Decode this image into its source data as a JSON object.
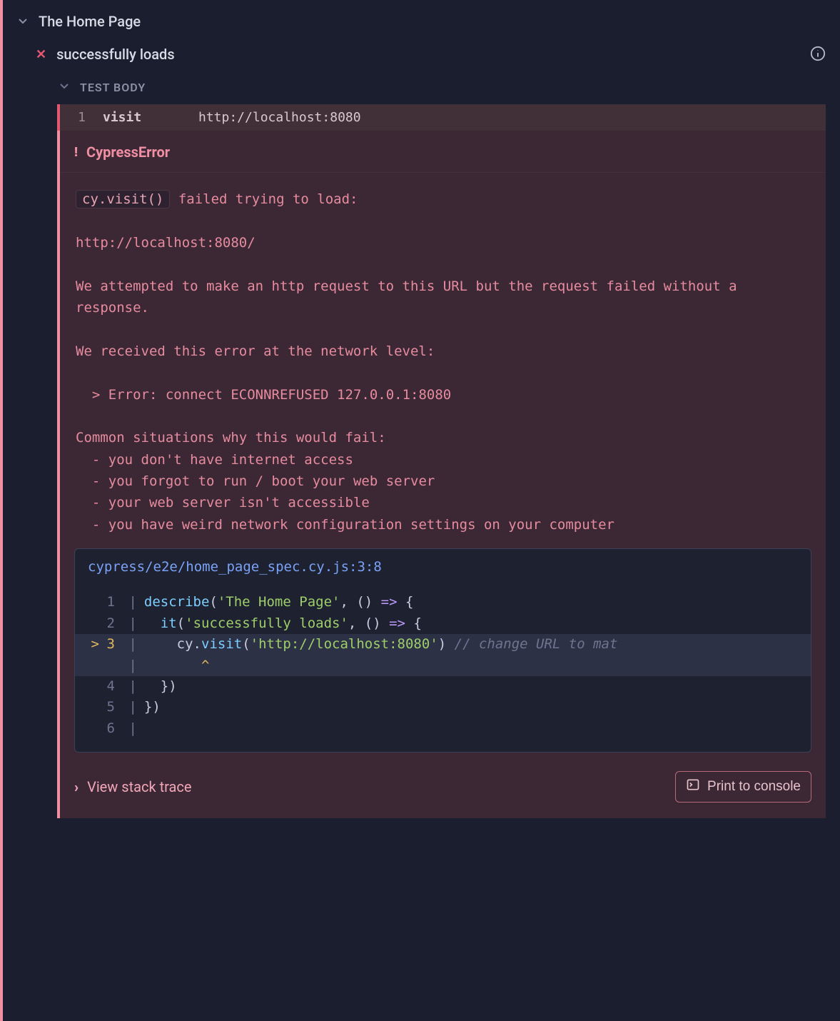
{
  "suite": {
    "title": "The Home Page"
  },
  "test": {
    "title": "successfully loads",
    "status": "failed"
  },
  "section": {
    "label": "TEST BODY"
  },
  "command": {
    "index": "1",
    "name": "visit",
    "arg": "http://localhost:8080"
  },
  "error": {
    "title": "CypressError",
    "code_chip": "cy.visit()",
    "msg_after_chip": " failed trying to load:",
    "url": "http://localhost:8080/",
    "para1": "We attempted to make an http request to this URL but the request failed without a response.",
    "para2": "We received this error at the network level:",
    "net_error": "  > Error: connect ECONNREFUSED 127.0.0.1:8080",
    "common_header": "Common situations why this would fail:",
    "bullets": [
      "  - you don't have internet access",
      "  - you forgot to run / boot your web server",
      "  - your web server isn't accessible",
      "  - you have weird network configuration settings on your computer"
    ]
  },
  "code": {
    "path": "cypress/e2e/home_page_spec.cy.js:3:8",
    "caret": "       ^",
    "lines": [
      {
        "n": "1",
        "hl": false,
        "tokens": [
          [
            "fn",
            "describe"
          ],
          [
            "punc",
            "("
          ],
          [
            "str",
            "'The Home Page'"
          ],
          [
            "punc",
            ", () "
          ],
          [
            "kw",
            "=>"
          ],
          [
            "punc",
            " {"
          ]
        ]
      },
      {
        "n": "2",
        "hl": false,
        "tokens": [
          [
            "punc",
            "  "
          ],
          [
            "fn",
            "it"
          ],
          [
            "punc",
            "("
          ],
          [
            "str",
            "'successfully loads'"
          ],
          [
            "punc",
            ", () "
          ],
          [
            "kw",
            "=>"
          ],
          [
            "punc",
            " {"
          ]
        ]
      },
      {
        "n": "3",
        "hl": true,
        "tokens": [
          [
            "punc",
            "    "
          ],
          [
            "id",
            "cy"
          ],
          [
            "punc",
            "."
          ],
          [
            "fn",
            "visit"
          ],
          [
            "punc",
            "("
          ],
          [
            "str",
            "'http://localhost:8080'"
          ],
          [
            "punc",
            ") "
          ],
          [
            "comment",
            "// change URL to mat"
          ]
        ]
      },
      {
        "n": "4",
        "hl": false,
        "tokens": [
          [
            "punc",
            "  })"
          ]
        ]
      },
      {
        "n": "5",
        "hl": false,
        "tokens": [
          [
            "punc",
            "})"
          ]
        ]
      },
      {
        "n": "6",
        "hl": false,
        "tokens": []
      }
    ]
  },
  "footer": {
    "stack_label": "View stack trace",
    "print_label": "Print to console"
  }
}
